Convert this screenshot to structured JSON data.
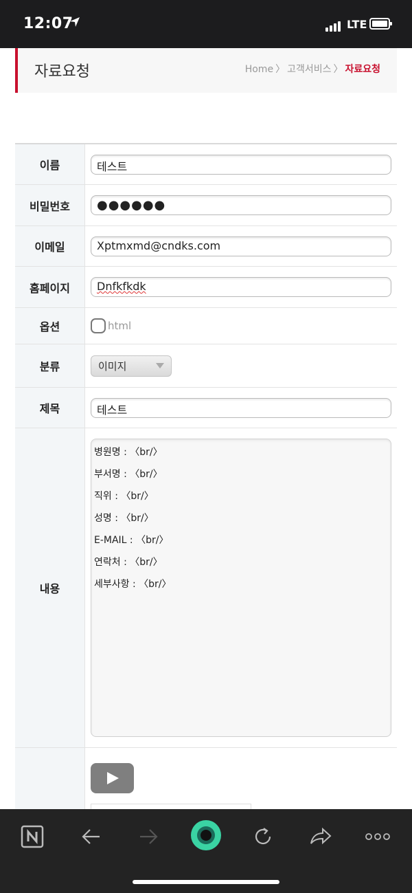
{
  "status_bar": {
    "time": "12:07",
    "network": "LTE"
  },
  "header": {
    "title": "자료요청",
    "breadcrumb": {
      "home": "Home",
      "sep": "〉",
      "level1": "고객서비스",
      "current": "자료요청"
    }
  },
  "form": {
    "name": {
      "label": "이름",
      "value": "테스트"
    },
    "password": {
      "label": "비밀번호",
      "value": "●●●●●●"
    },
    "email": {
      "label": "이메일",
      "value": "Xptmxmd@cndks.com"
    },
    "homepage": {
      "label": "홈페이지",
      "value": "Dnfkfkdk"
    },
    "option": {
      "label": "옵션",
      "checkbox_label": "html",
      "checked": false
    },
    "category": {
      "label": "분류",
      "selected": "이미지"
    },
    "subject": {
      "label": "제목",
      "value": "테스트"
    },
    "content": {
      "label": "내용",
      "lines": [
        "병원명 : 〈br/〉",
        "부서명 : 〈br/〉",
        "직위 : 〈br/〉",
        "성명 : 〈br/〉",
        "E-MAIL : 〈br/〉",
        "연락처 : 〈br/〉",
        "세부사항 : 〈br/〉"
      ]
    }
  },
  "colors": {
    "accent": "#c8102e",
    "label_bg": "#f3f6f8",
    "toolbar_bg": "#232323",
    "toolbar_center": "#3ad3a3"
  },
  "toolbar": {
    "icons": [
      "naver-n-icon",
      "back-arrow-icon",
      "forward-arrow-icon",
      "home-dot-icon",
      "refresh-icon",
      "share-icon",
      "more-icon"
    ]
  }
}
